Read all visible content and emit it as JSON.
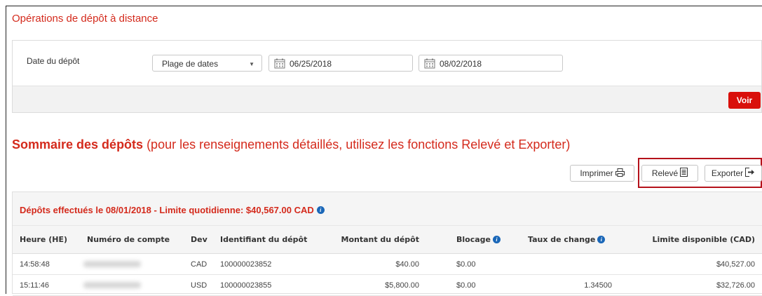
{
  "page": {
    "title": "Opérations de dépôt à distance"
  },
  "filter": {
    "label": "Date du dépôt",
    "range_select": "Plage de dates",
    "date_from": "06/25/2018",
    "date_to": "08/02/2018",
    "submit_label": "Voir"
  },
  "summary": {
    "title_bold": "Sommaire des dépôts",
    "title_note": " (pour les renseignements détaillés, utilisez les fonctions Relevé et Exporter)",
    "print_label": "Imprimer",
    "statement_label": "Relevé",
    "export_label": "Exporter"
  },
  "deposits": {
    "heading": "Dépôts effectués le 08/01/2018 - Limite quotidienne: $40,567.00 CAD",
    "columns": [
      "Heure (HE)",
      "Numéro de compte",
      "Dev",
      "Identifiant du dépôt",
      "Montant du dépôt",
      "Blocage",
      "Taux de change",
      "Limite disponible (CAD)"
    ],
    "rows": [
      {
        "time": "14:58:48",
        "currency": "CAD",
        "deposit_id": "100000023852",
        "amount": "$40.00",
        "hold": "$0.00",
        "rate": "",
        "available": "$40,527.00"
      },
      {
        "time": "15:11:46",
        "currency": "USD",
        "deposit_id": "100000023855",
        "amount": "$5,800.00",
        "hold": "$0.00",
        "rate": "1.34500",
        "available": "$32,726.00"
      }
    ]
  },
  "colors": {
    "accent_red": "#d42a1c",
    "button_red": "#d9100b",
    "info_blue": "#1a67b8",
    "highlight_border": "#b5121b"
  },
  "icons": {
    "calendar": "calendar-icon",
    "print": "printer-icon",
    "statement": "document-icon",
    "export": "export-icon",
    "info": "info-icon",
    "caret": "caret-down-icon"
  }
}
